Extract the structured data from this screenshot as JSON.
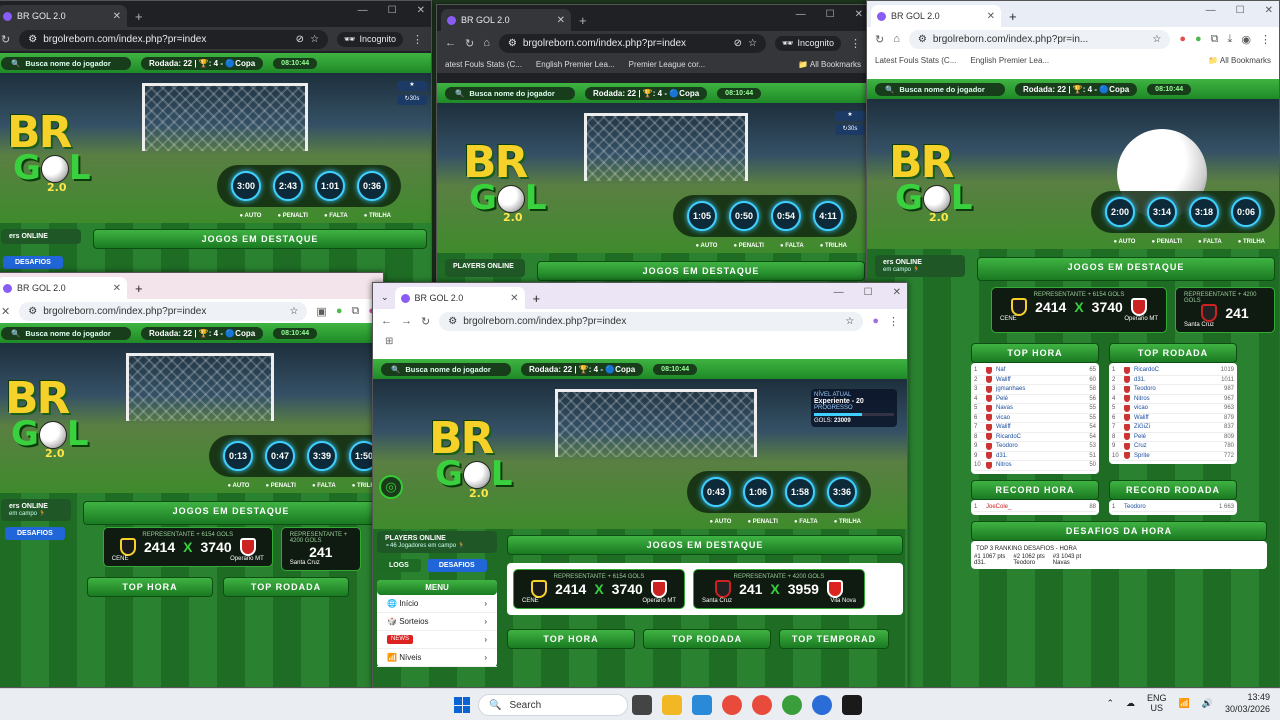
{
  "tabs": {
    "title": "BR GOL 2.0"
  },
  "url": "brgolreborn.com/index.php?pr=index",
  "url_truncated": "brgolreborn.com/index.php?pr=in...",
  "incognito_label": "Incognito",
  "bookmarks": {
    "b1": "Latest Fouls Stats (C...",
    "b2": "English Premier Lea...",
    "b3": "Premier League cor...",
    "all": "All Bookmarks",
    "b1_short": "atest Fouls Stats (C..."
  },
  "game": {
    "search_placeholder": "Busca nome do jogador",
    "rodada": "Rodada: 22 | 🏆: 4 - 🔵Copa",
    "clock": "08:10:44",
    "version": "2.0",
    "timer_labels": [
      "● AUTO",
      "● PENALTI",
      "● FALTA",
      "● TRILHA"
    ],
    "players_online": "PLAYERS ONLINE",
    "players_online_short": "ers ONLINE",
    "players_count": "⚬46 Jogadores em campo 🏃",
    "players_count_short": "em campo 🏃",
    "logs": "LOGS",
    "desafios": "DESAFIOS",
    "jogos_destaque": "JOGOS EM DESTAQUE",
    "menu": "MENU",
    "menu_items": [
      "Início",
      "Sorteios",
      "NEWS",
      "Níveis"
    ],
    "match1": {
      "rep": "REPRESENTANTE + 6154 GOLS",
      "home": "CENE",
      "away": "Operario MT",
      "hs": "2414",
      "as": "3740"
    },
    "match2": {
      "rep": "REPRESENTANTE + 4200 GOLS",
      "home": "Santa Cruz",
      "away": "Vila Nova",
      "hs": "241",
      "as": "3959"
    },
    "top_hora": "TOP HORA",
    "top_rodada": "TOP RODADA",
    "top_temporada": "TOP TEMPORAD",
    "record_hora": "RECORD HORA",
    "record_rodada": "RECORD RODADA",
    "desafios_hora": "DESAFIOS DA HORA",
    "top3_label": "TOP 3 RANKING DESAFIOS - HORA",
    "nivel_atual": "NÍVEL ATUAL",
    "nivel": "Experiente - 20",
    "progresso": "PROGRESSO",
    "gols_label": "GOLS:",
    "gols": "23009",
    "badge_30s": "↻30s",
    "top_hora_rows": [
      {
        "n": "1",
        "name": "Naf",
        "pts": "65"
      },
      {
        "n": "2",
        "name": "Waliff",
        "pts": "60"
      },
      {
        "n": "3",
        "name": "jgmanhaes",
        "pts": "58"
      },
      {
        "n": "4",
        "name": "Pelé",
        "pts": "56"
      },
      {
        "n": "5",
        "name": "Navas",
        "pts": "55"
      },
      {
        "n": "6",
        "name": "vicao",
        "pts": "55"
      },
      {
        "n": "7",
        "name": "Waliff",
        "pts": "54"
      },
      {
        "n": "8",
        "name": "RicardoC",
        "pts": "54"
      },
      {
        "n": "9",
        "name": "Teodoro",
        "pts": "53"
      },
      {
        "n": "9",
        "name": "d31.",
        "pts": "51"
      },
      {
        "n": "10",
        "name": "Nitros",
        "pts": "50"
      }
    ],
    "top_rodada_rows": [
      {
        "n": "1",
        "name": "RicardoC",
        "pts": "1019"
      },
      {
        "n": "2",
        "name": "d31.",
        "pts": "1011"
      },
      {
        "n": "3",
        "name": "Teodoro",
        "pts": "987"
      },
      {
        "n": "4",
        "name": "Nitros",
        "pts": "967"
      },
      {
        "n": "5",
        "name": "vicao",
        "pts": "963"
      },
      {
        "n": "6",
        "name": "Waliff",
        "pts": "879"
      },
      {
        "n": "7",
        "name": "ZiGiZi",
        "pts": "837"
      },
      {
        "n": "8",
        "name": "Pelé",
        "pts": "809"
      },
      {
        "n": "9",
        "name": "Cruz",
        "pts": "780"
      },
      {
        "n": "10",
        "name": "Sprite",
        "pts": "772"
      }
    ],
    "record_hora_row": {
      "name": "JoeCole_",
      "pts": "88"
    },
    "record_rodada_row": {
      "name": "Teodoro",
      "pts": "1 663"
    },
    "top3": [
      {
        "pos": "#1",
        "pts": "1067 pts",
        "name": "d31."
      },
      {
        "pos": "#2",
        "pts": "1062 pts",
        "name": "Teodoro"
      },
      {
        "pos": "#3",
        "pts": "1043 pt",
        "name": "Navas"
      }
    ]
  },
  "windows": {
    "w1_timers": [
      "3:00",
      "2:43",
      "1:01",
      "0:36"
    ],
    "w2_timers": [
      "1:05",
      "0:50",
      "0:54",
      "4:11"
    ],
    "w3_timers": [
      "2:00",
      "3:14",
      "3:18",
      "0:06"
    ],
    "w4_timers": [
      "0:13",
      "0:47",
      "3:39",
      "1:50"
    ],
    "w5_timers": [
      "0:43",
      "1:06",
      "1:58",
      "3:36"
    ]
  },
  "taskbar": {
    "search": "Search",
    "lang1": "ENG",
    "lang2": "US",
    "time": "13:49",
    "date": "30/03/2026"
  },
  "colors": {
    "accent": "#2bd13b",
    "logo_yellow": "#f5d12a",
    "timer_ring": "#3fd0ff"
  }
}
